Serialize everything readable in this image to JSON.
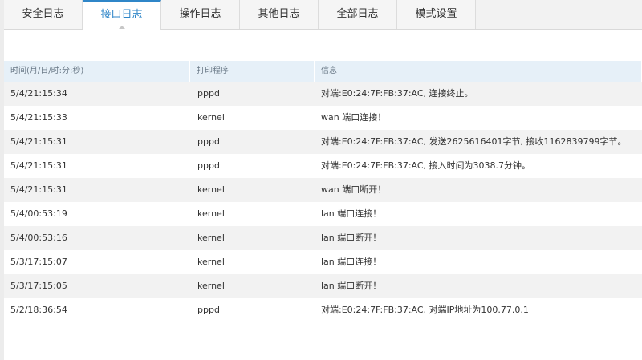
{
  "tabs": [
    {
      "label": "安全日志",
      "active": false
    },
    {
      "label": "接口日志",
      "active": true
    },
    {
      "label": "操作日志",
      "active": false
    },
    {
      "label": "其他日志",
      "active": false
    },
    {
      "label": "全部日志",
      "active": false
    },
    {
      "label": "模式设置",
      "active": false
    }
  ],
  "table": {
    "headers": [
      "时间(月/日/时:分:秒)",
      "打印程序",
      "信息"
    ],
    "rows": [
      [
        "5/4/21:15:34",
        "pppd",
        "对端:E0:24:7F:FB:37:AC, 连接终止。"
      ],
      [
        "5/4/21:15:33",
        "kernel",
        "wan 端口连接！"
      ],
      [
        "5/4/21:15:31",
        "pppd",
        "对端:E0:24:7F:FB:37:AC, 发送2625616401字节, 接收1162839799字节。"
      ],
      [
        "5/4/21:15:31",
        "pppd",
        "对端:E0:24:7F:FB:37:AC, 接入时间为3038.7分钟。"
      ],
      [
        "5/4/21:15:31",
        "kernel",
        "wan 端口断开！"
      ],
      [
        "5/4/00:53:19",
        "kernel",
        "lan 端口连接！"
      ],
      [
        "5/4/00:53:16",
        "kernel",
        "lan 端口断开！"
      ],
      [
        "5/3/17:15:07",
        "kernel",
        "lan 端口连接！"
      ],
      [
        "5/3/17:15:05",
        "kernel",
        "lan 端口断开！"
      ],
      [
        "5/2/18:36:54",
        "pppd",
        "对端:E0:24:7F:FB:37:AC, 对端IP地址为100.77.0.1"
      ]
    ]
  }
}
